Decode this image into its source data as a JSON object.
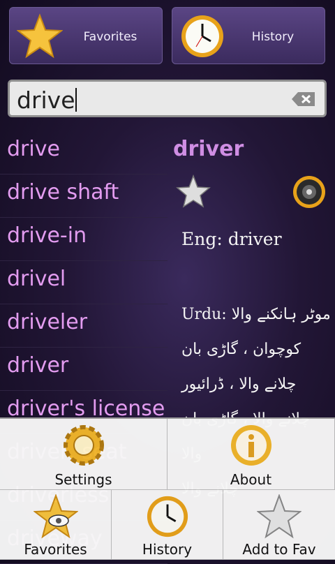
{
  "top": {
    "favorites_label": "Favorites",
    "history_label": "History"
  },
  "search": {
    "value": "drive"
  },
  "words": [
    "drive",
    "drive shaft",
    "drive-in",
    "drivel",
    "driveler",
    "driver",
    "driver's license",
    "driver, seat",
    "driverless",
    "driveway"
  ],
  "detail": {
    "headword": "driver",
    "eng": "Eng: driver",
    "urdu_lines": [
      "Urdu: موٹر ہانکنے والا",
      "کوچوان ، گاڑی بان",
      "چلانے والا ، ڈرائیور",
      "چلانے والا ، گاڑی بان",
      "والا",
      "چلانے والا"
    ]
  },
  "menu": {
    "settings": "Settings",
    "about": "About",
    "favorites": "Favorites",
    "history": "History",
    "add_to_fav": "Add to Fav"
  },
  "colors": {
    "word": "#e39cf0",
    "headword": "#cf8ee3",
    "star": "#f5c13a"
  }
}
